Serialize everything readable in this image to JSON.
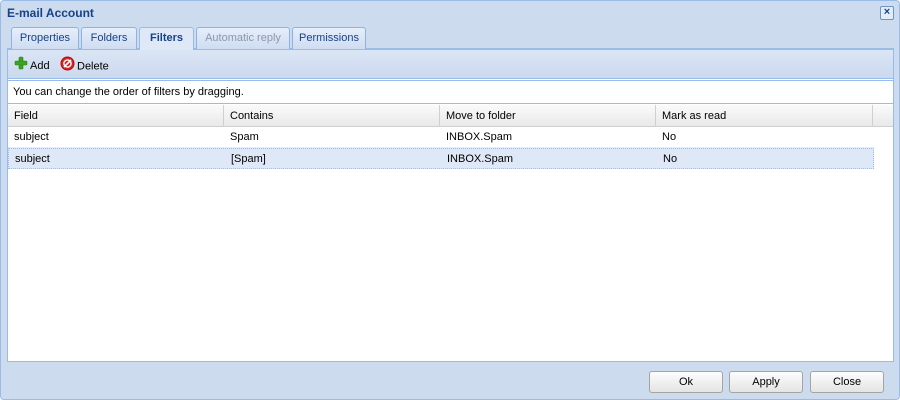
{
  "window": {
    "title": "E-mail Account",
    "close_icon": "close-icon"
  },
  "tabs": [
    {
      "label": "Properties",
      "state": "normal"
    },
    {
      "label": "Folders",
      "state": "normal"
    },
    {
      "label": "Filters",
      "state": "active"
    },
    {
      "label": "Automatic reply",
      "state": "disabled"
    },
    {
      "label": "Permissions",
      "state": "normal"
    }
  ],
  "toolbar": {
    "add_label": "Add",
    "add_icon": "plus-icon",
    "delete_label": "Delete",
    "delete_icon": "delete-icon"
  },
  "info_text": "You can change the order of filters by dragging.",
  "grid": {
    "columns": [
      "Field",
      "Contains",
      "Move to folder",
      "Mark as read"
    ],
    "rows": [
      {
        "field": "subject",
        "contains": "Spam",
        "folder": "INBOX.Spam",
        "mark_read": "No",
        "selected": false
      },
      {
        "field": "subject",
        "contains": "[Spam]",
        "folder": "INBOX.Spam",
        "mark_read": "No",
        "selected": true
      }
    ]
  },
  "footer": {
    "ok_label": "Ok",
    "apply_label": "Apply",
    "close_label": "Close"
  },
  "colors": {
    "title": "#15428b",
    "frame": "#cddbee",
    "border": "#99bbe8",
    "selection": "#dfe8f6"
  }
}
